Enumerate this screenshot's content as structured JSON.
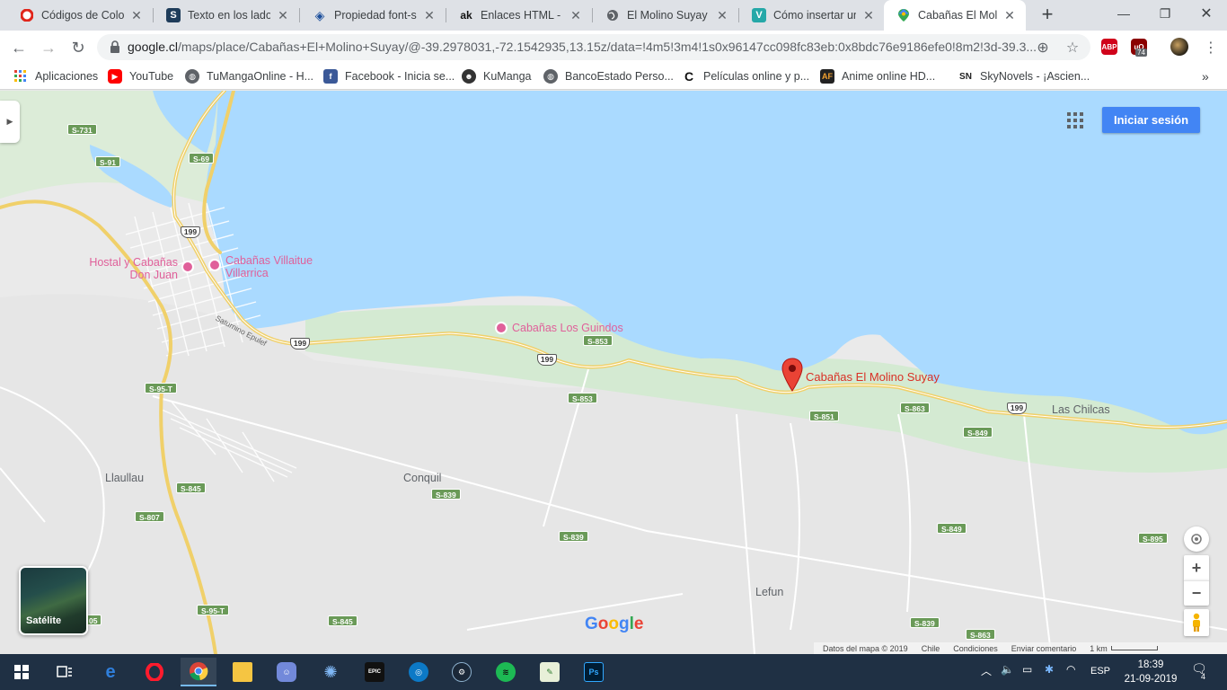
{
  "tabs": [
    {
      "title": "Códigos de Colores",
      "icon": "opera-icon"
    },
    {
      "title": "Texto en los lados",
      "icon": "s-favicon-icon"
    },
    {
      "title": "Propiedad font-size",
      "icon": "diamond-favicon-icon"
    },
    {
      "title": "Enlaces HTML - Hi",
      "icon": "ak-favicon-icon"
    },
    {
      "title": "El Molino Suyay",
      "icon": "globe-icon"
    },
    {
      "title": "Cómo insertar un",
      "icon": "v-favicon-icon"
    },
    {
      "title": "Cabañas El Molino",
      "icon": "google-maps-icon",
      "active": true
    }
  ],
  "address_bar": {
    "host": "google.cl",
    "path": "/maps/place/Cabañas+El+Molino+Suyay/@-39.2978031,-72.1542935,13.15z/data=!4m5!3m4!1s0x96147cc098fc83eb:0x8bdc76e9186efe0!8m2!3d-39.3..."
  },
  "extensions": {
    "abp": "ABP",
    "badge": "74"
  },
  "bookmarks": [
    {
      "label": "Aplicaciones",
      "icon": "apps-grid-icon"
    },
    {
      "label": "YouTube",
      "icon": "youtube-icon"
    },
    {
      "label": "TuMangaOnline - H...",
      "icon": "globe-icon"
    },
    {
      "label": "Facebook - Inicia se...",
      "icon": "facebook-icon"
    },
    {
      "label": "KuManga",
      "icon": "kumanga-icon"
    },
    {
      "label": "BancoEstado Perso...",
      "icon": "globe-icon"
    },
    {
      "label": "Películas online y p...",
      "icon": "c-favicon-icon"
    },
    {
      "label": "Anime online HD...",
      "icon": "af-favicon-icon"
    },
    {
      "label": "SkyNovels - ¡Ascien...",
      "icon": "sn-favicon-icon"
    }
  ],
  "map": {
    "signin_label": "Iniciar sesión",
    "satellite_label": "Satélite",
    "selected_place": "Cabañas El Molino Suyay",
    "pois": [
      {
        "line1": "Hostal y Cabañas",
        "line2": "Don Juan"
      },
      {
        "line1": "Cabañas Villaitue",
        "line2": "Villarrica"
      },
      {
        "line1": "Cabañas Los Guindos",
        "line2": ""
      }
    ],
    "places": [
      "Las Chilcas",
      "Llaullau",
      "Conquil",
      "Lefun"
    ],
    "street": "Saturnino Epulef",
    "roads_green": [
      "S-731",
      "S-91",
      "S-69",
      "S-853",
      "S-853",
      "S-95-T",
      "S-851",
      "S-863",
      "S-849",
      "S-845",
      "S-839",
      "S-807",
      "S-839",
      "S-849",
      "S-895",
      "S-95-T",
      "S-845",
      "S-839",
      "S-863",
      "05"
    ],
    "roads_white": [
      "199",
      "199",
      "199",
      "199"
    ],
    "logo": "Google",
    "footer": {
      "data": "Datos del mapa © 2019",
      "country": "Chile",
      "terms": "Condiciones",
      "feedback": "Enviar comentario",
      "scale": "1 km"
    }
  },
  "taskbar": {
    "language": "ESP",
    "time": "18:39",
    "date": "21-09-2019",
    "notifications": "4",
    "apps": [
      "windows-start-icon",
      "task-view-icon",
      "edge-icon",
      "opera-icon",
      "chrome-icon",
      "file-explorer-icon",
      "discord-icon",
      "unreal-icon",
      "epic-games-icon",
      "uplay-icon",
      "steam-icon",
      "spotify-icon",
      "notepad-icon",
      "photoshop-icon"
    ]
  }
}
